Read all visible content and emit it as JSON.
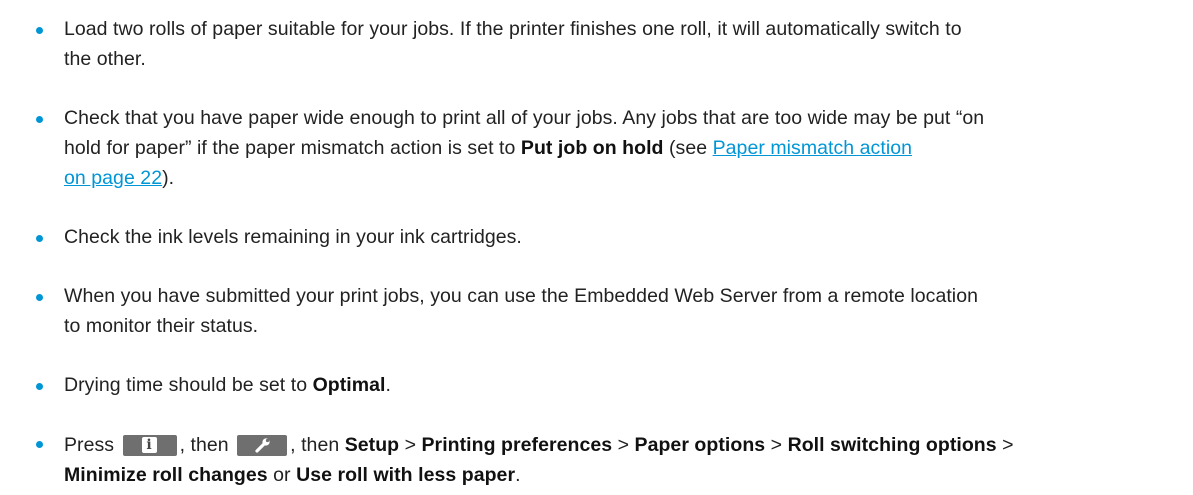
{
  "items": [
    {
      "text1": "Load two rolls of paper suitable for your jobs. If the printer finishes one roll, it will automatically switch to",
      "text2": "the other."
    },
    {
      "text1": "Check that you have paper wide enough to print all of your jobs. Any jobs that are too wide may be put “on",
      "text2a": "hold for paper” if the paper mismatch action is set to ",
      "bold_put_on_hold": "Put job on hold",
      "text2b": " (see ",
      "link_part1": "Paper mismatch action",
      "link_part2": "on page 22",
      "text3_end": ")."
    },
    {
      "text1": "Check the ink levels remaining in your ink cartridges."
    },
    {
      "text1": "When you have submitted your print jobs, you can use the Embedded Web Server from a remote location",
      "text2": "to monitor their status."
    },
    {
      "text_before": "Drying time should be set to ",
      "bold_optimal": "Optimal",
      "text_after": "."
    },
    {
      "press": "Press ",
      "then1": ", then ",
      "then2": ", then ",
      "setup": "Setup",
      "sep1": " > ",
      "printing_preferences": "Printing preferences",
      "sep2": " > ",
      "paper_options": "Paper options",
      "sep3": " > ",
      "roll_switching_options": "Roll switching options",
      "sep4": " >",
      "minimize_roll_changes": "Minimize roll changes",
      "or": " or ",
      "use_roll_with_less_paper": "Use roll with less paper",
      "end": "."
    }
  ],
  "icons": {
    "info_glyph": "i",
    "bullet_color": "#0096d6",
    "link_color": "#0096d6",
    "button_color": "#6f6f6f"
  }
}
